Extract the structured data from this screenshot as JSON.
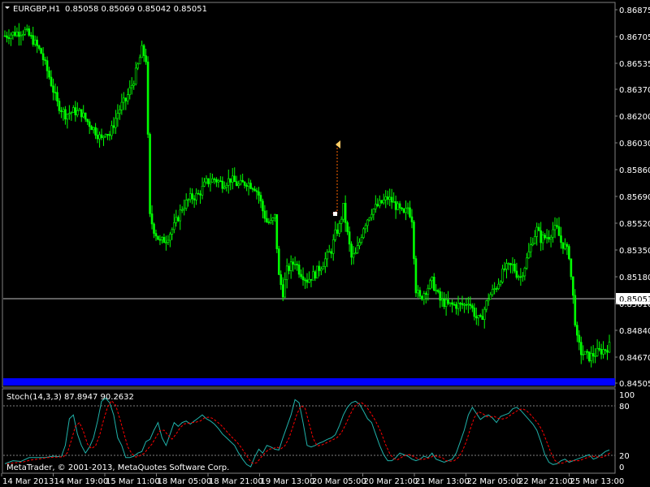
{
  "header": {
    "symbol": "EURGBP,H1",
    "quote": "0.85058 0.85069 0.85042 0.85051"
  },
  "indicator": {
    "label": "Stoch(14,3,3) 87.8947 90.2632",
    "levels": [
      "100",
      "80",
      "20",
      "0"
    ]
  },
  "footer": {
    "copyright": "MetaTrader, © 2001-2013, MetaQuotes Software Corp."
  },
  "colors": {
    "background": "#000000",
    "bull": "#00ff00",
    "bear": "#00ff00",
    "current_line": "#c0c0c0",
    "stoch_main": "#20b2aa",
    "stoch_signal": "#ff0000",
    "blue_band": "#0000ff",
    "arrow_up": "#ffcc66",
    "arrow_down": "#ff3333"
  },
  "chart_data": {
    "type": "candlestick",
    "timeframe": "H1",
    "y_axis_labels": [
      "0.86875",
      "0.86705",
      "0.86535",
      "0.86370",
      "0.86200",
      "0.86030",
      "0.85860",
      "0.85690",
      "0.85520",
      "0.85350",
      "0.85180",
      "0.85010",
      "0.84840",
      "0.84670",
      "0.84505"
    ],
    "current_price": "0.85051",
    "x_axis_labels": [
      "14 Mar 2013",
      "14 Mar 19:00",
      "15 Mar 11:00",
      "18 Mar 05:00",
      "18 Mar 21:00",
      "19 Mar 13:00",
      "20 Mar 05:00",
      "20 Mar 21:00",
      "21 Mar 13:00",
      "22 Mar 05:00",
      "22 Mar 21:00",
      "25 Mar 13:00"
    ],
    "ylim": [
      0.8445,
      0.869
    ],
    "close_path": [
      [
        0,
        0.8671
      ],
      [
        6,
        0.8673
      ],
      [
        10,
        0.8674
      ],
      [
        14,
        0.8668
      ],
      [
        18,
        0.866
      ],
      [
        22,
        0.8645
      ],
      [
        26,
        0.8628
      ],
      [
        30,
        0.8621
      ],
      [
        34,
        0.8623
      ],
      [
        38,
        0.8622
      ],
      [
        40,
        0.8618
      ],
      [
        44,
        0.8612
      ],
      [
        48,
        0.8605
      ],
      [
        50,
        0.8611
      ],
      [
        52,
        0.8608
      ],
      [
        56,
        0.8622
      ],
      [
        58,
        0.8627
      ],
      [
        60,
        0.863
      ],
      [
        64,
        0.8643
      ],
      [
        66,
        0.8652
      ],
      [
        68,
        0.8662
      ],
      [
        70,
        0.8656
      ],
      [
        72,
        0.8556
      ],
      [
        74,
        0.8548
      ],
      [
        77,
        0.854
      ],
      [
        80,
        0.8542
      ],
      [
        84,
        0.855
      ],
      [
        88,
        0.8562
      ],
      [
        92,
        0.8568
      ],
      [
        96,
        0.857
      ],
      [
        100,
        0.8578
      ],
      [
        104,
        0.858
      ],
      [
        108,
        0.8577
      ],
      [
        112,
        0.858
      ],
      [
        116,
        0.8576
      ],
      [
        120,
        0.8578
      ],
      [
        124,
        0.8575
      ],
      [
        126,
        0.857
      ],
      [
        128,
        0.856
      ],
      [
        130,
        0.8553
      ],
      [
        132,
        0.8552
      ],
      [
        134,
        0.8556
      ],
      [
        136,
        0.8518
      ],
      [
        138,
        0.8508
      ],
      [
        140,
        0.8522
      ],
      [
        144,
        0.8528
      ],
      [
        146,
        0.8522
      ],
      [
        150,
        0.8516
      ],
      [
        154,
        0.852
      ],
      [
        158,
        0.8527
      ],
      [
        162,
        0.8535
      ],
      [
        164,
        0.8545
      ],
      [
        166,
        0.855
      ],
      [
        168,
        0.8562
      ],
      [
        170,
        0.8545
      ],
      [
        172,
        0.853
      ],
      [
        174,
        0.8532
      ],
      [
        176,
        0.854
      ],
      [
        178,
        0.855
      ],
      [
        182,
        0.856
      ],
      [
        186,
        0.8564
      ],
      [
        190,
        0.8568
      ],
      [
        192,
        0.8566
      ],
      [
        196,
        0.856
      ],
      [
        198,
        0.8557
      ],
      [
        200,
        0.8562
      ],
      [
        202,
        0.8555
      ],
      [
        204,
        0.851
      ],
      [
        206,
        0.8504
      ],
      [
        208,
        0.8508
      ],
      [
        212,
        0.8515
      ],
      [
        216,
        0.8503
      ],
      [
        220,
        0.85
      ],
      [
        224,
        0.85
      ],
      [
        228,
        0.85
      ],
      [
        230,
        0.8503
      ],
      [
        234,
        0.8492
      ],
      [
        236,
        0.849
      ],
      [
        240,
        0.8505
      ],
      [
        244,
        0.8512
      ],
      [
        248,
        0.8523
      ],
      [
        252,
        0.8525
      ],
      [
        254,
        0.852
      ],
      [
        256,
        0.8518
      ],
      [
        258,
        0.8525
      ],
      [
        260,
        0.8533
      ],
      [
        262,
        0.8542
      ],
      [
        264,
        0.8548
      ],
      [
        266,
        0.8542
      ],
      [
        270,
        0.8544
      ],
      [
        272,
        0.8548
      ],
      [
        274,
        0.8548
      ],
      [
        276,
        0.854
      ],
      [
        278,
        0.8537
      ],
      [
        280,
        0.8532
      ],
      [
        281,
        0.8518
      ],
      [
        282,
        0.8505
      ],
      [
        283,
        0.849
      ],
      [
        284,
        0.8478
      ],
      [
        286,
        0.847
      ],
      [
        290,
        0.8467
      ],
      [
        294,
        0.847
      ],
      [
        298,
        0.8472
      ],
      [
        300,
        0.8474
      ]
    ],
    "stoch_path": [
      [
        0,
        6
      ],
      [
        4,
        10
      ],
      [
        8,
        9
      ],
      [
        12,
        14
      ],
      [
        16,
        14
      ],
      [
        20,
        14
      ],
      [
        24,
        16
      ],
      [
        28,
        15
      ],
      [
        30,
        30
      ],
      [
        32,
        65
      ],
      [
        34,
        70
      ],
      [
        36,
        45
      ],
      [
        38,
        30
      ],
      [
        40,
        20
      ],
      [
        42,
        28
      ],
      [
        44,
        40
      ],
      [
        46,
        62
      ],
      [
        48,
        88
      ],
      [
        50,
        92
      ],
      [
        52,
        86
      ],
      [
        54,
        70
      ],
      [
        56,
        40
      ],
      [
        58,
        30
      ],
      [
        60,
        14
      ],
      [
        62,
        14
      ],
      [
        64,
        16
      ],
      [
        66,
        20
      ],
      [
        68,
        22
      ],
      [
        70,
        35
      ],
      [
        72,
        38
      ],
      [
        74,
        50
      ],
      [
        76,
        60
      ],
      [
        78,
        40
      ],
      [
        80,
        30
      ],
      [
        82,
        45
      ],
      [
        84,
        60
      ],
      [
        86,
        55
      ],
      [
        88,
        60
      ],
      [
        90,
        62
      ],
      [
        92,
        58
      ],
      [
        94,
        62
      ],
      [
        96,
        66
      ],
      [
        98,
        70
      ],
      [
        100,
        65
      ],
      [
        102,
        62
      ],
      [
        104,
        58
      ],
      [
        106,
        52
      ],
      [
        108,
        45
      ],
      [
        110,
        40
      ],
      [
        112,
        35
      ],
      [
        114,
        30
      ],
      [
        116,
        20
      ],
      [
        118,
        12
      ],
      [
        120,
        5
      ],
      [
        122,
        2
      ],
      [
        124,
        15
      ],
      [
        126,
        25
      ],
      [
        128,
        20
      ],
      [
        130,
        30
      ],
      [
        132,
        28
      ],
      [
        134,
        25
      ],
      [
        136,
        24
      ],
      [
        138,
        40
      ],
      [
        140,
        55
      ],
      [
        142,
        70
      ],
      [
        144,
        90
      ],
      [
        146,
        86
      ],
      [
        148,
        60
      ],
      [
        150,
        30
      ],
      [
        152,
        28
      ],
      [
        154,
        30
      ],
      [
        156,
        33
      ],
      [
        158,
        35
      ],
      [
        160,
        38
      ],
      [
        162,
        40
      ],
      [
        164,
        44
      ],
      [
        166,
        56
      ],
      [
        168,
        70
      ],
      [
        170,
        80
      ],
      [
        172,
        86
      ],
      [
        174,
        88
      ],
      [
        176,
        84
      ],
      [
        178,
        75
      ],
      [
        180,
        65
      ],
      [
        182,
        60
      ],
      [
        184,
        45
      ],
      [
        186,
        30
      ],
      [
        188,
        18
      ],
      [
        190,
        10
      ],
      [
        192,
        10
      ],
      [
        194,
        14
      ],
      [
        196,
        20
      ],
      [
        198,
        18
      ],
      [
        200,
        16
      ],
      [
        202,
        12
      ],
      [
        204,
        10
      ],
      [
        206,
        12
      ],
      [
        208,
        16
      ],
      [
        210,
        14
      ],
      [
        212,
        20
      ],
      [
        214,
        12
      ],
      [
        216,
        10
      ],
      [
        218,
        8
      ],
      [
        220,
        10
      ],
      [
        222,
        12
      ],
      [
        224,
        20
      ],
      [
        226,
        35
      ],
      [
        228,
        50
      ],
      [
        230,
        70
      ],
      [
        232,
        80
      ],
      [
        234,
        72
      ],
      [
        236,
        64
      ],
      [
        238,
        68
      ],
      [
        240,
        70
      ],
      [
        242,
        66
      ],
      [
        244,
        60
      ],
      [
        246,
        68
      ],
      [
        248,
        70
      ],
      [
        250,
        72
      ],
      [
        252,
        78
      ],
      [
        254,
        80
      ],
      [
        256,
        76
      ],
      [
        258,
        70
      ],
      [
        260,
        64
      ],
      [
        262,
        58
      ],
      [
        264,
        50
      ],
      [
        266,
        35
      ],
      [
        268,
        18
      ],
      [
        270,
        8
      ],
      [
        272,
        5
      ],
      [
        274,
        6
      ],
      [
        276,
        10
      ],
      [
        278,
        12
      ],
      [
        280,
        8
      ],
      [
        282,
        10
      ],
      [
        284,
        12
      ],
      [
        286,
        14
      ],
      [
        288,
        16
      ],
      [
        290,
        18
      ],
      [
        292,
        12
      ],
      [
        294,
        14
      ],
      [
        296,
        18
      ],
      [
        298,
        22
      ],
      [
        300,
        24
      ]
    ]
  }
}
